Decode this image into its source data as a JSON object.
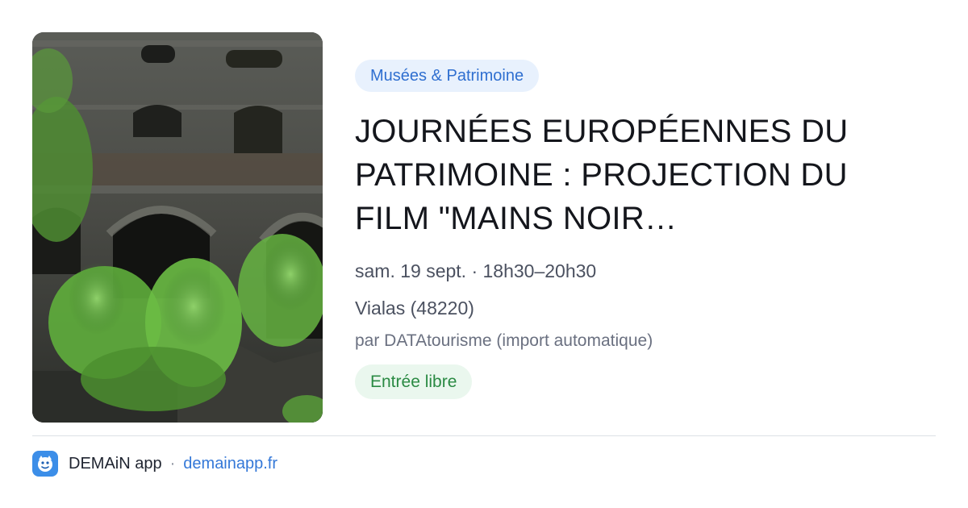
{
  "event": {
    "category": "Musées & Patrimoine",
    "title": "JOURNÉES EUROPÉENNES DU PATRIMOINE : PROJECTION DU FILM \"MAINS NOIR…",
    "datetime": "sam. 19 sept. · 18h30–20h30",
    "location": "Vialas (48220)",
    "source": "par DATAtourisme (import automatique)",
    "price": "Entrée libre"
  },
  "footer": {
    "app_name": "DEMAiN app",
    "separator": "·",
    "domain": "demainapp.fr"
  },
  "colors": {
    "category_bg": "#e8f1fd",
    "category_text": "#2f6fd0",
    "price_bg": "#eaf7ee",
    "price_text": "#2a8a43",
    "link": "#3478d8",
    "app_icon": "#3c8ee8"
  },
  "icons": {
    "app_icon": "demain-app-icon",
    "photo": "stone-ruins-with-ferns-photo"
  }
}
